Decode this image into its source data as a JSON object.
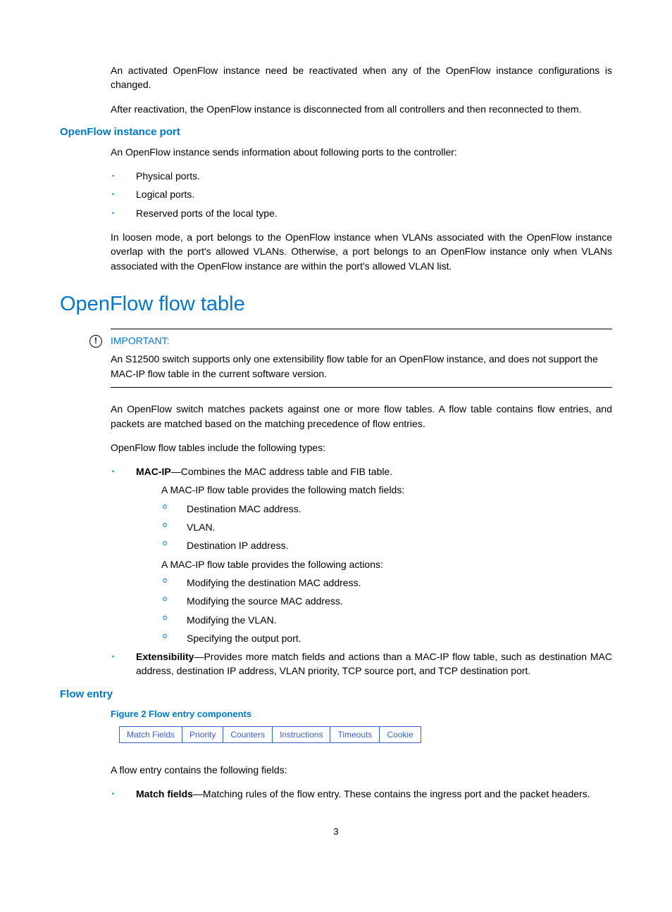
{
  "p1": "An activated OpenFlow instance need be reactivated when any of the OpenFlow instance configurations is changed.",
  "p2": "After reactivation, the OpenFlow instance is disconnected from all controllers and then reconnected to them.",
  "h3a": "OpenFlow instance port",
  "p3": "An OpenFlow instance sends information about following ports to the controller:",
  "ports": [
    "Physical ports.",
    "Logical ports.",
    "Reserved ports of the local type."
  ],
  "p4": "In loosen mode, a port belongs to the OpenFlow instance when VLANs associated with the OpenFlow instance overlap with the port's allowed VLANs. Otherwise, a port belongs to an OpenFlow instance only when VLANs associated with the OpenFlow instance are within the port's allowed VLAN list.",
  "h2a": "OpenFlow flow table",
  "important_label": "IMPORTANT:",
  "important_text": "An S12500 switch supports only one extensibility flow table for an OpenFlow instance, and does not support the MAC-IP flow table in the current software version.",
  "p5": "An OpenFlow switch matches packets against one or more flow tables. A flow table contains flow entries, and packets are matched based on the matching precedence of flow entries.",
  "p6": "OpenFlow flow tables include the following types:",
  "macip_label": "MAC-IP",
  "macip_desc": "—Combines the MAC address table and FIB table.",
  "macip_p1": "A MAC-IP flow table provides the following match fields:",
  "macip_sub1": [
    "Destination MAC address.",
    "VLAN.",
    "Destination IP address."
  ],
  "macip_p2": "A MAC-IP flow table provides the following actions:",
  "macip_sub2": [
    "Modifying the destination MAC address.",
    "Modifying the source MAC address.",
    "Modifying the VLAN.",
    "Specifying the output port."
  ],
  "ext_label": "Extensibility",
  "ext_desc": "—Provides more match fields and actions than a MAC-IP flow table, such as destination MAC address, destination IP address, VLAN priority, TCP source port, and TCP destination port.",
  "h3b": "Flow entry",
  "fig_caption": "Figure 2 Flow entry components",
  "flow_cells": [
    "Match Fields",
    "Priority",
    "Counters",
    "Instructions",
    "Timeouts",
    "Cookie"
  ],
  "p7": "A flow entry contains the following fields:",
  "mf_label": "Match fields",
  "mf_desc": "—Matching rules of the flow entry. These contains the ingress port and the packet headers.",
  "page_number": "3"
}
